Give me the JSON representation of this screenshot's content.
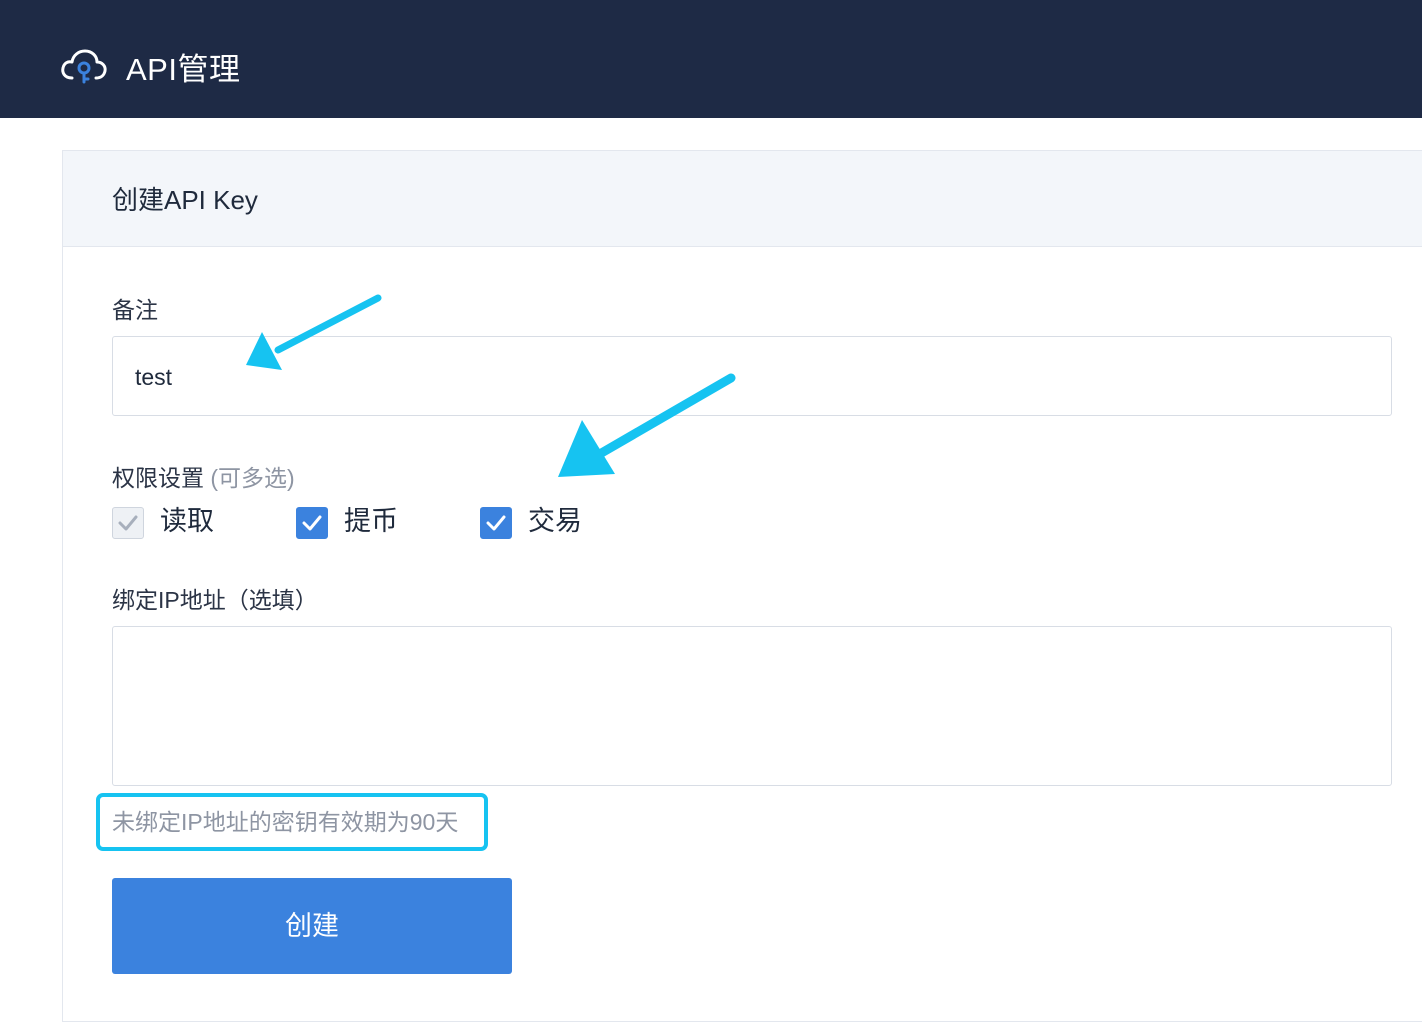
{
  "header": {
    "title": "API管理",
    "logo_icon": "cloud-key-icon"
  },
  "form": {
    "title": "创建API Key",
    "remark": {
      "label": "备注",
      "value": "test"
    },
    "permissions": {
      "label": "权限设置",
      "hint": "(可多选)",
      "options": [
        {
          "label": "读取",
          "checked": true,
          "disabled": true
        },
        {
          "label": "提币",
          "checked": true,
          "disabled": false
        },
        {
          "label": "交易",
          "checked": true,
          "disabled": false
        }
      ]
    },
    "ip": {
      "label": "绑定IP地址（选填）",
      "value": ""
    },
    "note": "未绑定IP地址的密钥有效期为90天",
    "submit_label": "创建"
  },
  "colors": {
    "header_bg": "#1e2a45",
    "primary": "#3b82de",
    "annotation": "#16c3f1",
    "hint_text": "#8e95a3"
  }
}
